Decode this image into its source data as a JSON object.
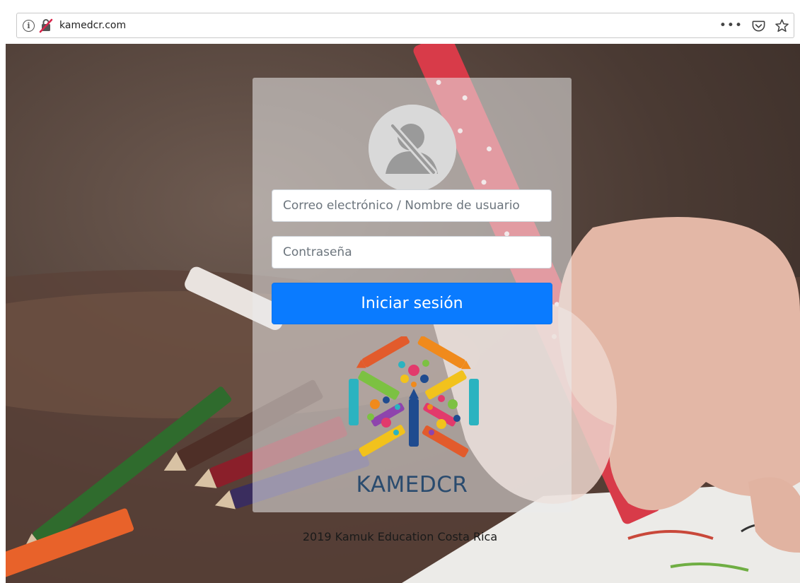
{
  "browser": {
    "url": "kamedcr.com",
    "icons": [
      "info-icon",
      "insecure-connection-icon",
      "more-actions-icon",
      "pocket-icon",
      "bookmark-star-icon"
    ],
    "more_label": "•••"
  },
  "login": {
    "avatar_icon": "user-avatar-icon",
    "email_placeholder": "Correo electrónico / Nombre de usuario",
    "password_placeholder": "Contraseña",
    "submit_label": "Iniciar sesión",
    "accent_color": "#0a7bff"
  },
  "brand": {
    "logo_icon": "crayons-hexagon-logo",
    "name": "KAMEDCR"
  },
  "footer": {
    "text": "2019 Kamuk Education Costa Rica"
  }
}
